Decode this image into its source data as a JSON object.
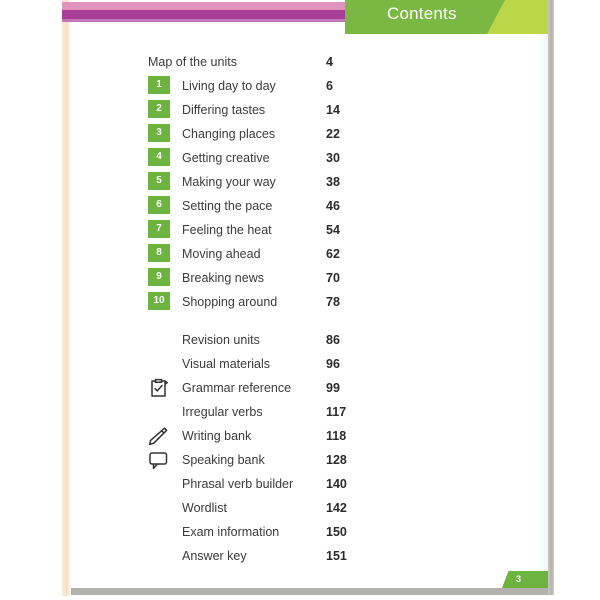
{
  "header": {
    "title": "Contents",
    "banner_color_dark": "#7ab843",
    "banner_color_light": "#bcd64a",
    "bar_pink": "#e094bd",
    "bar_magenta": "#a93d98"
  },
  "toc": {
    "badge_color": "#6cb33f",
    "entries": [
      {
        "badge": "",
        "icon": "",
        "label": "Map of the units",
        "page": "4",
        "indent": false,
        "gap_before": false
      },
      {
        "badge": "1",
        "icon": "",
        "label": "Living day to day",
        "page": "6",
        "indent": true,
        "gap_before": false
      },
      {
        "badge": "2",
        "icon": "",
        "label": "Differing tastes",
        "page": "14",
        "indent": true,
        "gap_before": false
      },
      {
        "badge": "3",
        "icon": "",
        "label": "Changing places",
        "page": "22",
        "indent": true,
        "gap_before": false
      },
      {
        "badge": "4",
        "icon": "",
        "label": "Getting creative",
        "page": "30",
        "indent": true,
        "gap_before": false
      },
      {
        "badge": "5",
        "icon": "",
        "label": "Making your way",
        "page": "38",
        "indent": true,
        "gap_before": false
      },
      {
        "badge": "6",
        "icon": "",
        "label": "Setting the pace",
        "page": "46",
        "indent": true,
        "gap_before": false
      },
      {
        "badge": "7",
        "icon": "",
        "label": "Feeling the heat",
        "page": "54",
        "indent": true,
        "gap_before": false
      },
      {
        "badge": "8",
        "icon": "",
        "label": "Moving ahead",
        "page": "62",
        "indent": true,
        "gap_before": false
      },
      {
        "badge": "9",
        "icon": "",
        "label": "Breaking news",
        "page": "70",
        "indent": true,
        "gap_before": false
      },
      {
        "badge": "10",
        "icon": "",
        "label": "Shopping around",
        "page": "78",
        "indent": true,
        "gap_before": false
      },
      {
        "badge": "",
        "icon": "",
        "label": "Revision units",
        "page": "86",
        "indent": true,
        "gap_before": true
      },
      {
        "badge": "",
        "icon": "",
        "label": "Visual materials",
        "page": "96",
        "indent": true,
        "gap_before": false
      },
      {
        "badge": "",
        "icon": "clipboard-check",
        "label": "Grammar reference",
        "page": "99",
        "indent": true,
        "gap_before": false
      },
      {
        "badge": "",
        "icon": "",
        "label": "Irregular verbs",
        "page": "117",
        "indent": true,
        "gap_before": false
      },
      {
        "badge": "",
        "icon": "pencil",
        "label": "Writing bank",
        "page": "118",
        "indent": true,
        "gap_before": false
      },
      {
        "badge": "",
        "icon": "speech-bubble",
        "label": "Speaking bank",
        "page": "128",
        "indent": true,
        "gap_before": false
      },
      {
        "badge": "",
        "icon": "",
        "label": "Phrasal verb builder",
        "page": "140",
        "indent": true,
        "gap_before": false
      },
      {
        "badge": "",
        "icon": "",
        "label": "Wordlist",
        "page": "142",
        "indent": true,
        "gap_before": false
      },
      {
        "badge": "",
        "icon": "",
        "label": "Exam information",
        "page": "150",
        "indent": true,
        "gap_before": false
      },
      {
        "badge": "",
        "icon": "",
        "label": "Answer key",
        "page": "151",
        "indent": true,
        "gap_before": false
      }
    ]
  },
  "footer": {
    "page_number": "3",
    "tab_color": "#6cb33f"
  }
}
